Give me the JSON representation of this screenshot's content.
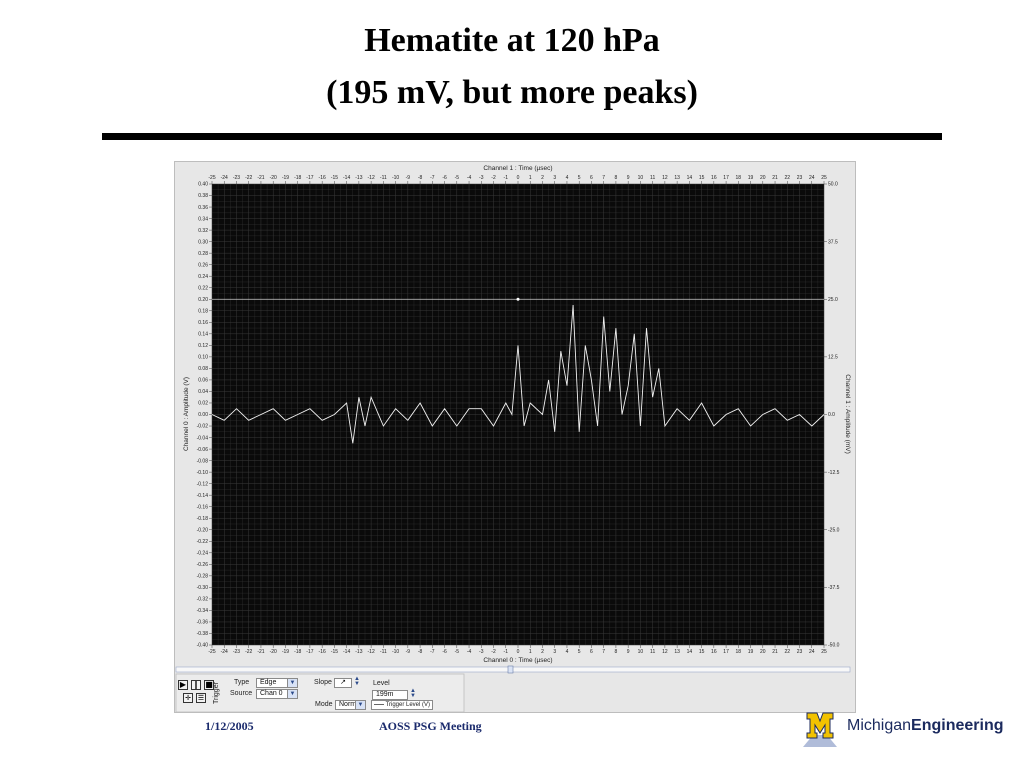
{
  "slide": {
    "title_line1": "Hematite at 120 hPa",
    "title_line2": "(195 mV, but more peaks)",
    "footer_date": "1/12/2005",
    "footer_meeting": "AOSS PSG Meeting",
    "logo_prefix": "Michigan",
    "logo_suffix": "Engineering"
  },
  "scope": {
    "top_axis_label": "Channel 1 : Time (µsec)",
    "bottom_axis_label": "Channel 0 : Time (µsec)",
    "left_axis_label": "Channel 0 : Amplitude (V)",
    "right_axis_label": "Channel 1 : Amplitude (mV)",
    "trigger_legend": "Trigger Level (V)",
    "colors": {
      "background": "#0a0a0a",
      "grid": "#3a3a3a",
      "trace": "#f2f2f2",
      "trigger_line": "#cfcfcf",
      "panel": "#e7e7e7"
    }
  },
  "controls": {
    "trigger_label": "Trigger",
    "type_label": "Type",
    "type_value": "Edge",
    "source_label": "Source",
    "source_value": "Chan 0",
    "slope_label": "Slope",
    "level_label": "Level",
    "level_value": "199m",
    "mode_label": "Mode",
    "mode_value": "Norm",
    "icons": [
      "play-icon",
      "pause-icon",
      "stop-icon",
      "zoom-icon",
      "cursor-icon"
    ]
  },
  "chart_data": {
    "type": "line",
    "title": "",
    "xlabel": "Channel 0 : Time (µsec)",
    "ylabel": "Channel 0 : Amplitude (V)",
    "xlim": [
      -25,
      25
    ],
    "ylim": [
      -0.4,
      0.4
    ],
    "y2label": "Channel 1 : Amplitude (mV)",
    "y2lim": [
      -50,
      50
    ],
    "x_ticks": [
      -25,
      -24,
      -23,
      -22,
      -21,
      -20,
      -19,
      -18,
      -17,
      -16,
      -15,
      -14,
      -13,
      -12,
      -11,
      -10,
      -9,
      -8,
      -7,
      -6,
      -5,
      -4,
      -3,
      -2,
      -1,
      0,
      1,
      2,
      3,
      4,
      5,
      6,
      7,
      8,
      9,
      10,
      11,
      12,
      13,
      14,
      15,
      16,
      17,
      18,
      19,
      20,
      21,
      22,
      23,
      24,
      25
    ],
    "y_ticks": [
      "0.40",
      "0.38",
      "0.36",
      "0.34",
      "0.32",
      "0.30",
      "0.28",
      "0.26",
      "0.24",
      "0.22",
      "0.20",
      "0.18",
      "0.16",
      "0.14",
      "0.12",
      "0.10",
      "0.08",
      "0.06",
      "0.04",
      "0.02",
      "0.00",
      "-0.02",
      "-0.04",
      "-0.06",
      "-0.08",
      "-0.10",
      "-0.12",
      "-0.14",
      "-0.16",
      "-0.18",
      "-0.20",
      "-0.22",
      "-0.24",
      "-0.26",
      "-0.28",
      "-0.30",
      "-0.32",
      "-0.34",
      "-0.36",
      "-0.38",
      "-0.40"
    ],
    "y2_ticks": [
      "50.0",
      "37.5",
      "25.0",
      "12.5",
      "0.0",
      "-12.5",
      "-25.0",
      "-37.5",
      "-50.0"
    ],
    "trigger_level": 0.2,
    "series": [
      {
        "x": [
          -25,
          -24,
          -23,
          -22,
          -21,
          -20,
          -19,
          -18,
          -17,
          -16,
          -15,
          -14,
          -13.5,
          -13,
          -12.5,
          -12,
          -11,
          -10,
          -9,
          -8,
          -7,
          -6,
          -5,
          -4,
          -3,
          -2,
          -1,
          -0.5,
          0,
          0.5,
          1,
          2,
          2.5,
          3,
          3.5,
          4,
          4.5,
          5,
          5.5,
          6,
          6.5,
          7,
          7.5,
          8,
          8.5,
          9,
          9.5,
          10,
          10.5,
          11,
          11.5,
          12,
          13,
          14,
          15,
          16,
          17,
          18,
          19,
          20,
          21,
          22,
          23,
          24,
          25
        ],
        "y": [
          0.0,
          -0.01,
          0.01,
          -0.01,
          0.0,
          0.01,
          -0.01,
          0.0,
          0.01,
          -0.01,
          0.0,
          0.02,
          -0.05,
          0.03,
          -0.02,
          0.03,
          -0.02,
          0.01,
          -0.01,
          0.02,
          -0.02,
          0.01,
          -0.02,
          0.01,
          0.01,
          -0.02,
          0.02,
          0.0,
          0.12,
          -0.02,
          0.02,
          0.0,
          0.06,
          -0.03,
          0.11,
          0.05,
          0.19,
          -0.03,
          0.12,
          0.06,
          -0.02,
          0.17,
          0.04,
          0.15,
          0.0,
          0.05,
          0.14,
          -0.02,
          0.15,
          0.03,
          0.08,
          -0.02,
          0.01,
          -0.01,
          0.02,
          -0.02,
          0.0,
          0.01,
          -0.02,
          0.0,
          0.01,
          -0.01,
          0.0,
          -0.02,
          0.0
        ]
      }
    ]
  }
}
